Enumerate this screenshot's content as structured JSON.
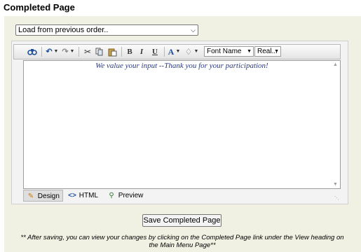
{
  "page": {
    "title": "Completed Page"
  },
  "load_select": {
    "value": "Load from previous order.."
  },
  "toolbar": {
    "font_name": "Font Name",
    "font_size": "Real..."
  },
  "editor": {
    "content_text": "We value your input --Thank you for your participation!",
    "modes": [
      {
        "label": "Design",
        "icon": "pencil-icon",
        "active": true
      },
      {
        "label": "HTML",
        "icon": "code-brackets-icon",
        "active": false
      },
      {
        "label": "Preview",
        "icon": "magnifier-icon",
        "active": false
      }
    ]
  },
  "save_button": {
    "label": "Save Completed Page"
  },
  "note": {
    "line1": "** After saving, you can view your changes by clicking on the Completed Page link under the View heading on",
    "line2": "the Main Menu Page**"
  },
  "colors": {
    "panel_bg": "#f0f1e3",
    "content_text": "#2c3a7c",
    "toolbar_icon_blue": "#1f4e9c"
  }
}
